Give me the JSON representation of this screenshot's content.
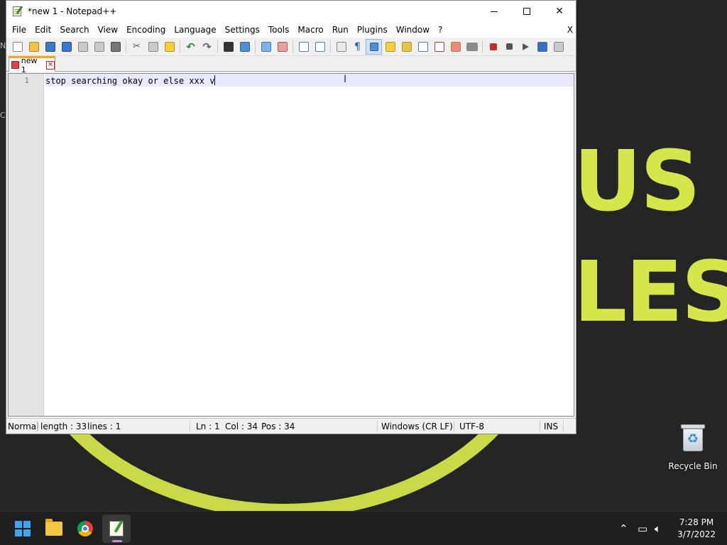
{
  "desktop": {
    "wallpaper_text_1": "US",
    "wallpaper_text_2": "LES",
    "edge_glyph_1": "N",
    "edge_glyph_2": "C",
    "recycle_bin_label": "Recycle Bin",
    "accent_color": "#d4e64a"
  },
  "window": {
    "title": "*new 1 - Notepad++",
    "close_glyph": "✕"
  },
  "menu": {
    "items": [
      "File",
      "Edit",
      "Search",
      "View",
      "Encoding",
      "Language",
      "Settings",
      "Tools",
      "Macro",
      "Run",
      "Plugins",
      "Window",
      "?"
    ],
    "close_label": "X"
  },
  "toolbar": {
    "icons": [
      "new-file-icon",
      "open-file-icon",
      "save-icon",
      "save-all-icon",
      "close-icon",
      "close-all-icon",
      "print-icon",
      "cut-icon",
      "copy-icon",
      "paste-icon",
      "undo-icon",
      "redo-icon",
      "find-icon",
      "replace-icon",
      "zoom-in-icon",
      "zoom-out-icon",
      "sync-vertical-icon",
      "sync-horizontal-icon",
      "word-wrap-icon",
      "show-all-chars-icon",
      "indent-guide-icon",
      "document-map-icon",
      "function-list-icon",
      "folder-workspace-icon",
      "monitoring-icon",
      "record-macro-icon",
      "stop-macro-icon",
      "play-macro-icon",
      "run-macro-multiple-icon",
      "save-macro-icon"
    ]
  },
  "tab": {
    "label": "new 1",
    "close_glyph": "✕"
  },
  "editor": {
    "line_number": "1",
    "text": "stop searching okay or else xxx v"
  },
  "status": {
    "mode": "Normal",
    "length": "length : 33",
    "lines": "lines : 1",
    "ln": "Ln : 1",
    "col": "Col : 34",
    "pos": "Pos : 34",
    "eol": "Windows (CR LF)",
    "encoding": "UTF-8",
    "insert_mode": "INS"
  },
  "taskbar": {
    "time": "7:28 PM",
    "date": "3/7/2022",
    "tray_chevron": "⌃"
  }
}
